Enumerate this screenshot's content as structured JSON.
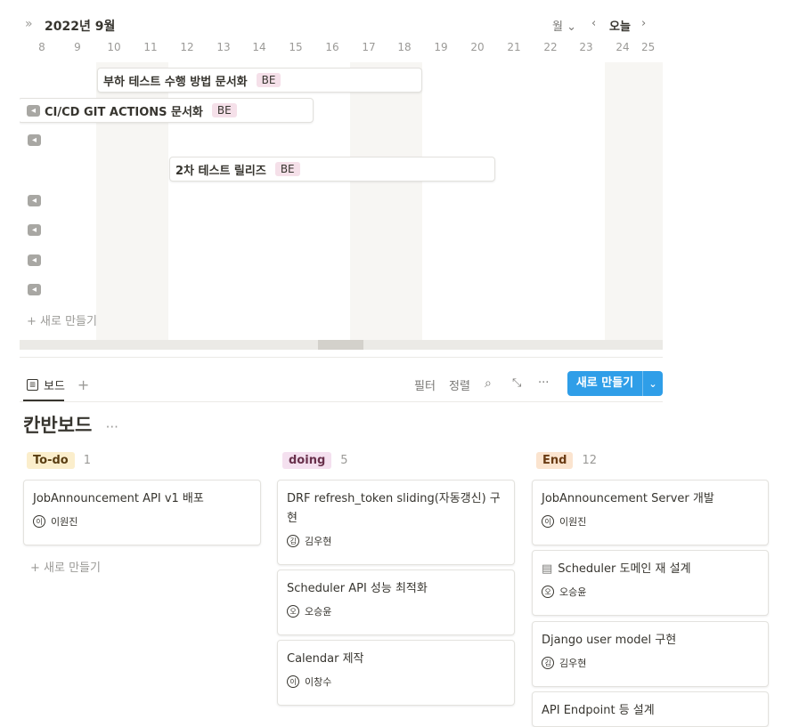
{
  "timeline": {
    "month": "2022년 9월",
    "view": "월",
    "today": "오늘",
    "days": [
      "8",
      "9",
      "10",
      "11",
      "12",
      "13",
      "14",
      "15",
      "16",
      "17",
      "18",
      "19",
      "20",
      "21",
      "22",
      "23",
      "24",
      "25"
    ],
    "bars": [
      {
        "title": "부하 테스트 수행 방법 문서화",
        "tag": "BE"
      },
      {
        "title": "CI/CD GIT ACTIONS 문서화",
        "tag": "BE"
      },
      {
        "title": "2차 테스트 릴리즈",
        "tag": "BE"
      }
    ],
    "new_label": "새로 만들기"
  },
  "toolbar": {
    "tab_label": "보드",
    "filter": "필터",
    "sort": "정렬",
    "new_button": "새로 만들기"
  },
  "board": {
    "title": "칸반보드",
    "new_label": "새로 만들기",
    "columns": [
      {
        "name": "To-do",
        "count": "1",
        "color": "#fbeecc",
        "cards": [
          {
            "title": "JobAnnouncement API v1 배포",
            "person": "이원진",
            "avatar": "이"
          }
        ]
      },
      {
        "name": "doing",
        "count": "5",
        "color": "#f4e0ef",
        "cards": [
          {
            "title": "DRF refresh_token sliding(자동갱신) 구현",
            "person": "김우현",
            "avatar": "김"
          },
          {
            "title": "Scheduler API  성능 최적화",
            "person": "오승윤",
            "avatar": "오"
          },
          {
            "title": "Calendar 제작",
            "person": "이창수",
            "avatar": "이"
          }
        ]
      },
      {
        "name": "End",
        "count": "12",
        "color": "#fbe4cf",
        "cards": [
          {
            "title": "JobAnnouncement Server 개발",
            "person": "이원진",
            "avatar": "이"
          },
          {
            "title": "Scheduler 도메인 재 설계",
            "person": "오승윤",
            "avatar": "오"
          },
          {
            "title": "Django user model 구현",
            "person": "김우현",
            "avatar": "김"
          },
          {
            "title": "API Endpoint 등 설계",
            "person": "",
            "avatar": ""
          }
        ]
      }
    ]
  }
}
